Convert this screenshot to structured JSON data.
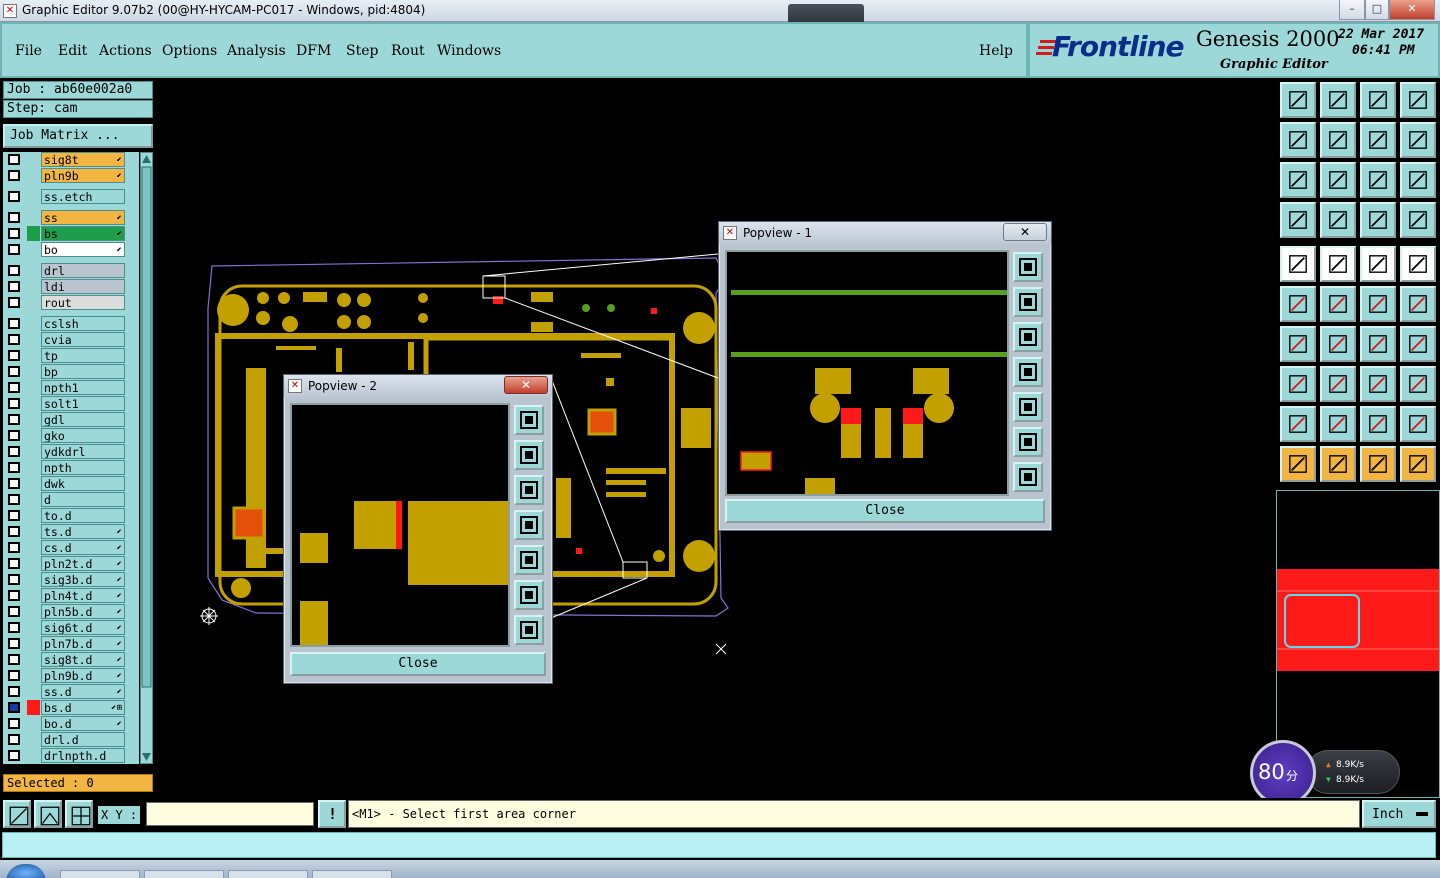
{
  "window": {
    "title": "Graphic Editor 9.07b2 (00@HY-HYCAM-PC017 - Windows, pid:4804)",
    "minimize": "–",
    "maximize": "□",
    "close": "✕"
  },
  "menu": {
    "file": "File",
    "edit": "Edit",
    "actions": "Actions",
    "options": "Options",
    "analysis": "Analysis",
    "dfm": "DFM",
    "step": "Step",
    "rout": "Rout",
    "windows": "Windows",
    "help": "Help"
  },
  "brand": {
    "logo": "Frontline",
    "product": "Genesis 2000",
    "subtitle": "Graphic Editor",
    "date": "22 Mar 2017",
    "time": "06:41 PM"
  },
  "job": {
    "job_label": "Job : ab60e002a0",
    "step_label": "Step: cam",
    "matrix_button": "Job Matrix ..."
  },
  "layers": [
    {
      "name": "sig8t",
      "color": "#f2b541",
      "flag": "⬋"
    },
    {
      "name": "pln9b",
      "color": "#f2b541",
      "flag": "⬋"
    },
    {
      "name": "ss.etch",
      "color": "",
      "flag": ""
    },
    {
      "name": "ss",
      "color": "#f2b541",
      "flag": "⬋"
    },
    {
      "name": "bs",
      "color": "#1e9e4a",
      "flag": "⬋"
    },
    {
      "name": "bo",
      "color": "#ffffff",
      "flag": "⬋"
    },
    {
      "name": "drl",
      "color": "#b9c4cf",
      "flag": ""
    },
    {
      "name": "ldi",
      "color": "#b9c4cf",
      "flag": ""
    },
    {
      "name": "rout",
      "color": "#dcdcdc",
      "flag": ""
    },
    {
      "name": "cslsh",
      "color": "",
      "flag": ""
    },
    {
      "name": "cvia",
      "color": "",
      "flag": ""
    },
    {
      "name": "tp",
      "color": "",
      "flag": ""
    },
    {
      "name": "bp",
      "color": "",
      "flag": ""
    },
    {
      "name": "npth1",
      "color": "",
      "flag": ""
    },
    {
      "name": "solt1",
      "color": "",
      "flag": ""
    },
    {
      "name": "gdl",
      "color": "",
      "flag": ""
    },
    {
      "name": "gko",
      "color": "",
      "flag": ""
    },
    {
      "name": "ydkdrl",
      "color": "",
      "flag": ""
    },
    {
      "name": "npth",
      "color": "",
      "flag": ""
    },
    {
      "name": "dwk",
      "color": "",
      "flag": ""
    },
    {
      "name": "d",
      "color": "",
      "flag": ""
    },
    {
      "name": "to.d",
      "color": "",
      "flag": ""
    },
    {
      "name": "ts.d",
      "color": "",
      "flag": "⬋"
    },
    {
      "name": "cs.d",
      "color": "",
      "flag": "⬋"
    },
    {
      "name": "pln2t.d",
      "color": "",
      "flag": "⬋"
    },
    {
      "name": "sig3b.d",
      "color": "",
      "flag": "⬋"
    },
    {
      "name": "pln4t.d",
      "color": "",
      "flag": "⬋"
    },
    {
      "name": "pln5b.d",
      "color": "",
      "flag": "⬋"
    },
    {
      "name": "sig6t.d",
      "color": "",
      "flag": "⬋"
    },
    {
      "name": "pln7b.d",
      "color": "",
      "flag": "⬋"
    },
    {
      "name": "sig8t.d",
      "color": "",
      "flag": "⬋"
    },
    {
      "name": "pln9b.d",
      "color": "",
      "flag": "⬋"
    },
    {
      "name": "ss.d",
      "color": "",
      "flag": "⬋"
    },
    {
      "name": "bs.d",
      "color": "#ff1a1a",
      "flag": "⬋⊞"
    },
    {
      "name": "bo.d",
      "color": "",
      "flag": "⬋"
    },
    {
      "name": "drl.d",
      "color": "",
      "flag": ""
    },
    {
      "name": "drlnpth.d",
      "color": "",
      "flag": ""
    }
  ],
  "selected": "Selected : 0",
  "popview1": {
    "title": "Popview - 1",
    "close": "Close",
    "x": "✕"
  },
  "popview2": {
    "title": "Popview - 2",
    "close": "Close",
    "x": "✕"
  },
  "command": {
    "xy_label": "X Y :",
    "xy_value": "",
    "message": "<M1> - Select first area corner",
    "units": "Inch"
  },
  "overlay": {
    "score": "80",
    "score_unit": "分",
    "up_rate": "8.9K/s",
    "down_rate": "8.9K/s"
  },
  "colors": {
    "panel": "#9cd8d8",
    "copper": "#c2a000",
    "trace": "#5a9e1e",
    "highlight": "#ff1a1a"
  }
}
